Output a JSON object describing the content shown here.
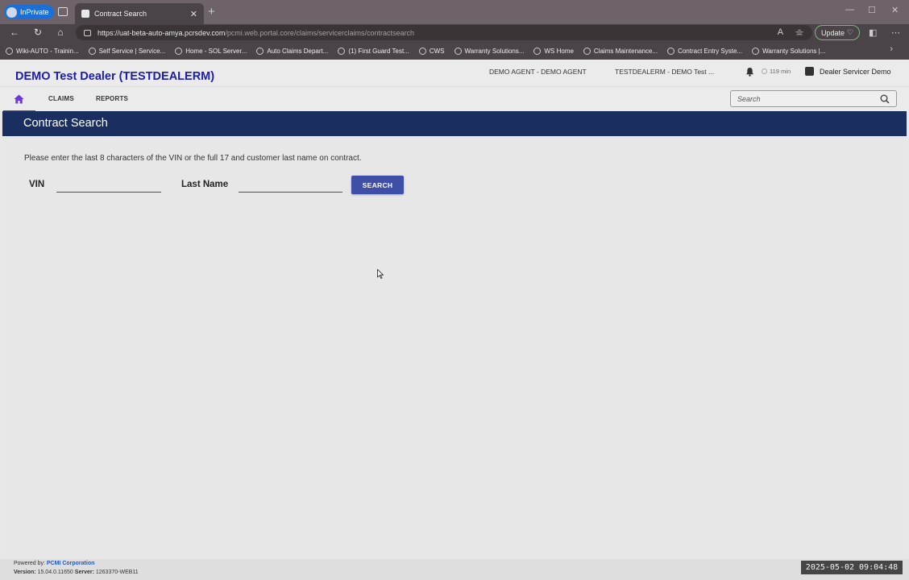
{
  "browser": {
    "inprivate_label": "InPrivate",
    "tab_title": "Contract Search",
    "url_host": "https://uat-beta-auto-amya.pcrsdev.com",
    "url_path": "/pcmi.web.portal.core/claims/servicerclaims/contractsearch",
    "update_label": "Update",
    "bookmarks": [
      "Wiki-AUTO - Trainin...",
      "Self Service | Service...",
      "Home - SOL Server...",
      "Auto Claims Depart...",
      "(1) First Guard Test...",
      "CWS",
      "Warranty Solutions...",
      "WS Home",
      "Claims Maintenance...",
      "Contract Entry Syste...",
      "Warranty Solutions |..."
    ]
  },
  "header": {
    "dealer_title": "DEMO Test Dealer (TESTDEALERM)",
    "agent": "DEMO AGENT - DEMO AGENT",
    "dealer_code": "TESTDEALERM - DEMO Test ...",
    "session_time": "119 min",
    "user_name": "Dealer Servicer Demo"
  },
  "nav": {
    "items": [
      "CLAIMS",
      "REPORTS"
    ],
    "search_placeholder": "Search"
  },
  "page": {
    "title": "Contract Search",
    "instructions": "Please enter the last 8 characters of the VIN or the full 17 and customer last name on contract.",
    "vin_label": "VIN",
    "vin_value": "",
    "last_name_label": "Last Name",
    "last_name_value": "",
    "search_button": "SEARCH"
  },
  "footer": {
    "powered_by": "Powered by:",
    "company": "PCMI Corporation",
    "version_label": "Version:",
    "version": "15.04.0.11650",
    "server_label": "Server:",
    "server": "1263370-WEB11",
    "timestamp": "2025-05-02 09:04:48"
  },
  "colors": {
    "banner": "#1a2f60",
    "dealer_title": "#1c1cb0",
    "search_button": "#3f4fa8",
    "home_indicator": "#6a3bd8"
  }
}
